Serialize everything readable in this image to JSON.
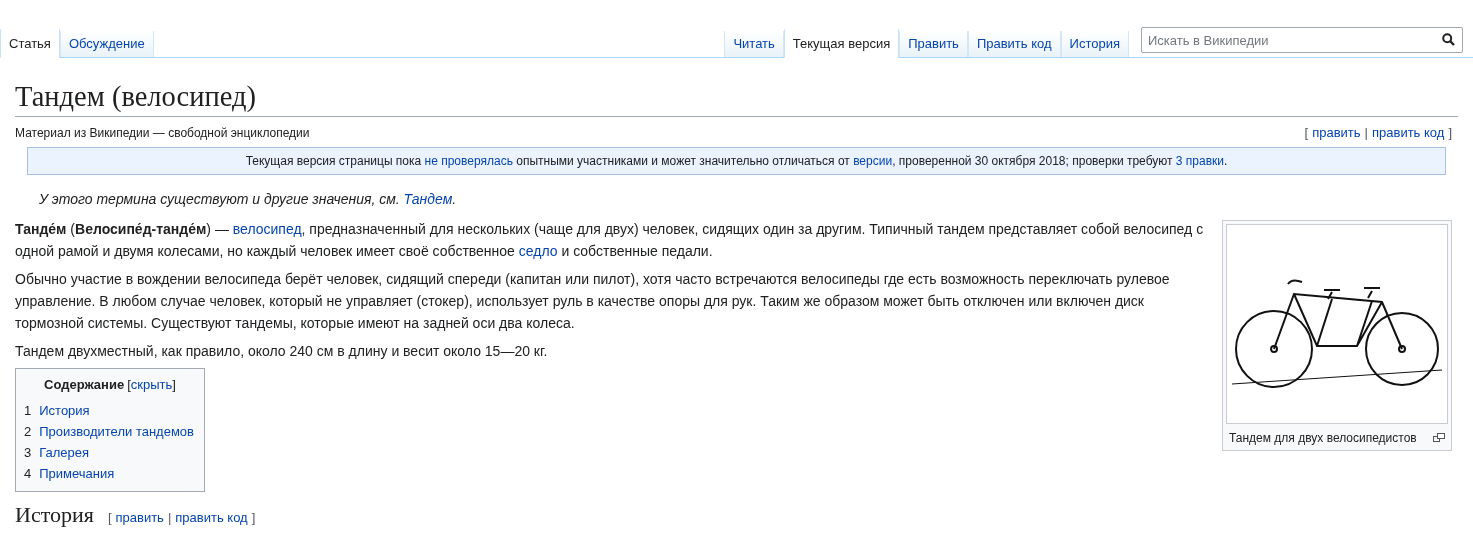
{
  "tabs_left": [
    {
      "label": "Статья",
      "selected": true
    },
    {
      "label": "Обсуждение",
      "selected": false
    }
  ],
  "tabs_right": [
    {
      "label": "Читать",
      "selected": false
    },
    {
      "label": "Текущая версия",
      "selected": true
    },
    {
      "label": "Править",
      "selected": false
    },
    {
      "label": "Править код",
      "selected": false
    },
    {
      "label": "История",
      "selected": false
    }
  ],
  "search": {
    "placeholder": "Искать в Википедии"
  },
  "title": "Тандем (велосипед)",
  "tagline": "Материал из Википедии — свободной энциклопедии",
  "edit_links": {
    "open": "[",
    "items": [
      "править",
      "править код"
    ],
    "sep": "|",
    "close": "]"
  },
  "notice": [
    {
      "text": "Текущая версия страницы пока ",
      "link": false
    },
    {
      "text": "не проверялась",
      "link": true
    },
    {
      "text": " опытными участниками и может значительно отличаться от ",
      "link": false
    },
    {
      "text": "версии",
      "link": true
    },
    {
      "text": ", проверенной 30 октября 2018; проверки требуют ",
      "link": false
    },
    {
      "text": "3 правки",
      "link": true
    },
    {
      "text": ".",
      "link": false
    }
  ],
  "hatnote": [
    {
      "text": "У этого термина существуют и другие значения, см. ",
      "link": false
    },
    {
      "text": "Тандем",
      "link": true
    },
    {
      "text": ".",
      "link": false
    }
  ],
  "paragraphs": [
    [
      {
        "text": "**Танде́м** (**Велосипе́д-танде́м**) — ",
        "link": false
      },
      {
        "text": "велосипед",
        "link": true
      },
      {
        "text": ", предназначенный для нескольких (чаще для двух) человек, сидящих один за другим. Типичный тандем представляет собой велосипед с одной рамой и двумя колесами, но каждый человек имеет своё собственное ",
        "link": false
      },
      {
        "text": "седло",
        "link": true
      },
      {
        "text": " и собственные педали.",
        "link": false
      }
    ],
    [
      {
        "text": "Обычно участие в вождении велосипеда берёт человек, сидящий спереди (капитан или пилот), хотя часто встречаются велосипеды где есть возможность переключать рулевое управление. В любом случае человек, который не управляет (стокер), использует руль в качестве опоры для рук. Таким же образом может быть отключен или включен диск тормозной системы. Существуют тандемы, которые имеют на задней оси два колеса.",
        "link": false
      }
    ],
    [
      {
        "text": "Тандем двухместный, как правило, около 240 см в длину и весит около 15—20 кг.",
        "link": false
      }
    ]
  ],
  "toc": {
    "title": "Содержание",
    "toggle_open": "[",
    "toggle": "скрыть",
    "toggle_close": "]",
    "items": [
      {
        "number": "1",
        "label": "История"
      },
      {
        "number": "2",
        "label": "Производители тандемов"
      },
      {
        "number": "3",
        "label": "Галерея"
      },
      {
        "number": "4",
        "label": "Примечания"
      }
    ]
  },
  "figure": {
    "caption": "Тандем для двух велосипедистов"
  },
  "section": {
    "heading": "История",
    "edit_links": {
      "open": "[",
      "items": [
        "править",
        "править код"
      ],
      "sep": "|",
      "close": "]"
    }
  }
}
